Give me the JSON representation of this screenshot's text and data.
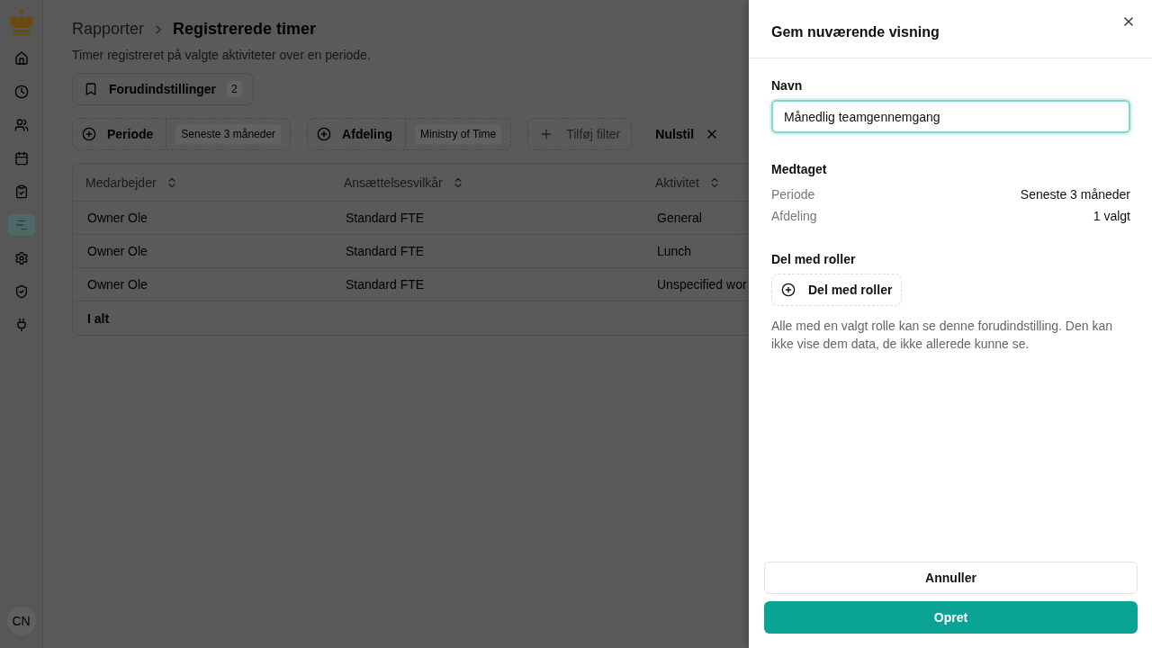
{
  "sidebar": {
    "items": [
      {
        "kind": "home",
        "selected": false
      },
      {
        "kind": "clock",
        "selected": false
      },
      {
        "kind": "users",
        "selected": false
      },
      {
        "kind": "calendar",
        "selected": false
      },
      {
        "kind": "clipboard",
        "selected": false
      },
      {
        "kind": "chart",
        "selected": true
      },
      {
        "kind": "settings",
        "selected": false
      },
      {
        "kind": "shield",
        "selected": false
      },
      {
        "kind": "plug",
        "selected": false
      }
    ],
    "avatar": "CN"
  },
  "breadcrumb": {
    "parent": "Rapporter",
    "current": "Registrerede timer"
  },
  "subtitle": "Timer registreret på valgte aktiviteter over en periode.",
  "presets": {
    "label": "Forudindstillinger",
    "count": "2"
  },
  "filters": [
    {
      "label": "Periode",
      "value": "Seneste 3 måneder"
    },
    {
      "label": "Afdeling",
      "value": "Ministry of Time"
    }
  ],
  "add_filter": "Tilføj filter",
  "reset": "Nulstil",
  "table": {
    "columns": [
      "Medarbejder",
      "Ansættelsesvilkår",
      "Aktivitet"
    ],
    "rows": [
      [
        "Owner Ole",
        "Standard FTE",
        "General"
      ],
      [
        "Owner Ole",
        "Standard FTE",
        "Lunch"
      ],
      [
        "Owner Ole",
        "Standard FTE",
        "Unspecified wor"
      ]
    ],
    "total": "I alt"
  },
  "drawer": {
    "title": "Gem nuværende visning",
    "name_label": "Navn",
    "name_value": "Månedlig teamgennemgang",
    "included_heading": "Medtaget",
    "included": [
      {
        "label": "Periode",
        "value": "Seneste 3 måneder"
      },
      {
        "label": "Afdeling",
        "value": "1 valgt"
      }
    ],
    "share_heading": "Del med roller",
    "share_button": "Del med roller",
    "note": "Alle med en valgt rolle kan se denne forudindstilling. Den kan ikke vise dem data, de ikke allerede kunne se.",
    "cancel": "Annuller",
    "create": "Opret"
  }
}
